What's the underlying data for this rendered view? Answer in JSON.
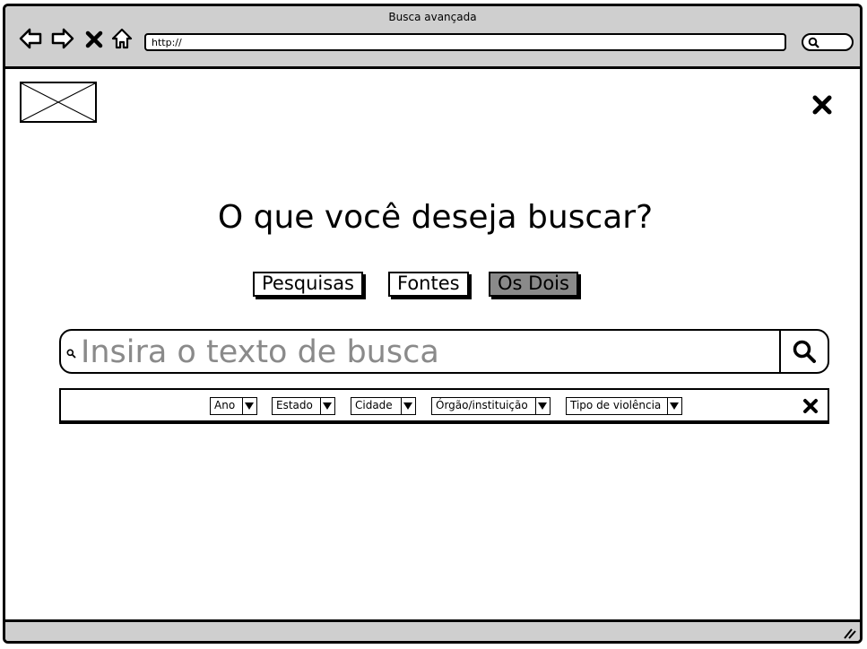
{
  "window": {
    "title": "Busca avançada"
  },
  "toolbar": {
    "back_icon": "arrow-left-icon",
    "forward_icon": "arrow-right-icon",
    "stop_icon": "close-icon",
    "home_icon": "home-icon",
    "url": "http://",
    "search_icon": "search-icon"
  },
  "page": {
    "logo": "image-placeholder",
    "close_icon": "close-icon",
    "heading": "O que você deseja buscar?",
    "scope_options": [
      {
        "label": "Pesquisas",
        "selected": false
      },
      {
        "label": "Fontes",
        "selected": false
      },
      {
        "label": "Os Dois",
        "selected": true
      }
    ],
    "search": {
      "placeholder": "Insira o texto de busca",
      "button_icon": "search-icon"
    },
    "filters": [
      {
        "label": "Ano"
      },
      {
        "label": "Estado"
      },
      {
        "label": "Cidade"
      },
      {
        "label": "Órgão/instituição"
      },
      {
        "label": "Tipo de violência"
      }
    ],
    "filters_close_icon": "close-icon"
  },
  "colors": {
    "chrome": "#cfcfcf",
    "selected_button": "#8a8a8a",
    "placeholder_text": "#8a8a8a"
  }
}
